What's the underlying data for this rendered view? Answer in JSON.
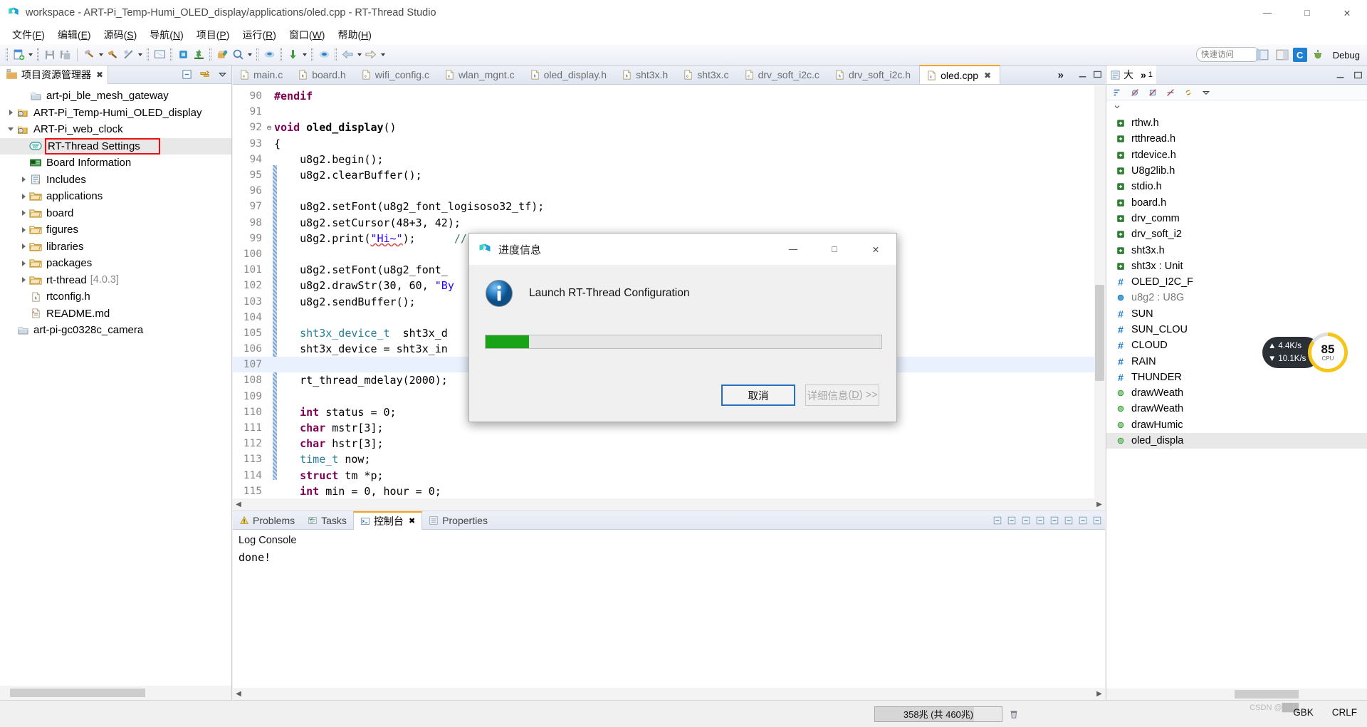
{
  "window": {
    "title": "workspace - ART-Pi_Temp-Humi_OLED_display/applications/oled.cpp - RT-Thread Studio",
    "minimize": "—",
    "maximize": "□",
    "close": "✕"
  },
  "menubar": {
    "items": [
      {
        "label": "文件",
        "mnemonic": "F"
      },
      {
        "label": "编辑",
        "mnemonic": "E"
      },
      {
        "label": "源码",
        "mnemonic": "S"
      },
      {
        "label": "导航",
        "mnemonic": "N"
      },
      {
        "label": "项目",
        "mnemonic": "P"
      },
      {
        "label": "运行",
        "mnemonic": "R"
      },
      {
        "label": "窗口",
        "mnemonic": "W"
      },
      {
        "label": "帮助",
        "mnemonic": "H"
      }
    ]
  },
  "toolbar": {
    "quick_access_placeholder": "快速访问",
    "perspective_c": "C",
    "perspective_debug": "Debug",
    "icons": [
      "new-project-icon",
      "save-icon",
      "save-all-icon",
      "build-hammer-icon",
      "build-all-icon",
      "clean-icon",
      "terminal-icon",
      "download-chip-icon",
      "flash-icon",
      "package-manager-icon",
      "search-icon",
      "sdk-manager-icon",
      "download-arrow-icon",
      "serial-icon",
      "back-icon",
      "forward-icon"
    ]
  },
  "project_explorer": {
    "tab_label": "项目资源管理器",
    "tab_close": "✖",
    "tools": [
      "collapse-all-icon",
      "link-editor-icon",
      "view-menu-icon"
    ],
    "nodes": [
      {
        "label": "art-pi_ble_mesh_gateway",
        "icon": "closed-project-icon",
        "indent": 1,
        "twisty": "none"
      },
      {
        "label": "ART-Pi_Temp-Humi_OLED_display",
        "icon": "c-project-icon",
        "indent": 0,
        "twisty": "collapsed"
      },
      {
        "label": "ART-Pi_web_clock",
        "icon": "c-project-icon",
        "indent": 0,
        "twisty": "expanded"
      },
      {
        "label": "RT-Thread Settings",
        "icon": "rt-settings-icon",
        "indent": 1,
        "twisty": "none",
        "selected": true,
        "highlighted": true
      },
      {
        "label": "Board Information",
        "icon": "board-info-icon",
        "indent": 1,
        "twisty": "none"
      },
      {
        "label": "Includes",
        "icon": "includes-icon",
        "indent": 1,
        "twisty": "collapsed"
      },
      {
        "label": "applications",
        "icon": "folder-icon",
        "indent": 1,
        "twisty": "collapsed"
      },
      {
        "label": "board",
        "icon": "folder-icon",
        "indent": 1,
        "twisty": "collapsed"
      },
      {
        "label": "figures",
        "icon": "folder-icon",
        "indent": 1,
        "twisty": "collapsed"
      },
      {
        "label": "libraries",
        "icon": "folder-icon",
        "indent": 1,
        "twisty": "collapsed"
      },
      {
        "label": "packages",
        "icon": "folder-icon",
        "indent": 1,
        "twisty": "collapsed"
      },
      {
        "label": "rt-thread",
        "version": "[4.0.3]",
        "icon": "folder-icon",
        "indent": 1,
        "twisty": "collapsed"
      },
      {
        "label": "rtconfig.h",
        "icon": "h-file-icon",
        "indent": 1,
        "twisty": "none"
      },
      {
        "label": "README.md",
        "icon": "md-file-icon",
        "indent": 1,
        "twisty": "none"
      },
      {
        "label": "art-pi-gc0328c_camera",
        "icon": "closed-project-icon",
        "indent": 0,
        "twisty": "none"
      }
    ]
  },
  "editor": {
    "tabs": [
      {
        "label": "main.c",
        "icon": "c-file-icon",
        "active": false
      },
      {
        "label": "board.h",
        "icon": "h-file-icon",
        "active": false
      },
      {
        "label": "wifi_config.c",
        "icon": "c-file-icon",
        "active": false
      },
      {
        "label": "wlan_mgnt.c",
        "icon": "c-file-icon",
        "active": false
      },
      {
        "label": "oled_display.h",
        "icon": "h-file-icon",
        "active": false
      },
      {
        "label": "sht3x.h",
        "icon": "h-file-icon",
        "active": false
      },
      {
        "label": "sht3x.c",
        "icon": "c-file-icon",
        "active": false
      },
      {
        "label": "drv_soft_i2c.c",
        "icon": "c-file-icon",
        "active": false
      },
      {
        "label": "drv_soft_i2c.h",
        "icon": "h-file-icon",
        "active": false
      },
      {
        "label": "oled.cpp",
        "icon": "cpp-file-icon",
        "active": true,
        "close": "✖"
      }
    ],
    "more_tabs": "»",
    "lines": [
      {
        "num": "90",
        "fold": "",
        "tokens": [
          {
            "t": "#endif",
            "c": "pp"
          }
        ]
      },
      {
        "num": "91",
        "fold": "",
        "tokens": []
      },
      {
        "num": "92",
        "fold": "⊖",
        "tokens": [
          {
            "t": "void ",
            "c": "kw"
          },
          {
            "t": "oled_display",
            "c": "fn"
          },
          {
            "t": "()",
            "c": ""
          }
        ]
      },
      {
        "num": "93",
        "fold": "",
        "tokens": [
          {
            "t": "{",
            "c": ""
          }
        ]
      },
      {
        "num": "94",
        "fold": "",
        "tokens": [
          {
            "t": "    u8g2.begin();",
            "c": ""
          }
        ]
      },
      {
        "num": "95",
        "fold": "",
        "tokens": [
          {
            "t": "    u8g2.clearBuffer();",
            "c": ""
          }
        ]
      },
      {
        "num": "96",
        "fold": "",
        "tokens": []
      },
      {
        "num": "97",
        "fold": "",
        "tokens": [
          {
            "t": "    u8g2.setFont(u8g2_font_logisoso32_tf);",
            "c": ""
          }
        ]
      },
      {
        "num": "98",
        "fold": "",
        "tokens": [
          {
            "t": "    u8g2.setCursor(48+3, 42);",
            "c": ""
          }
        ]
      },
      {
        "num": "99",
        "fold": "",
        "tokens": [
          {
            "t": "    u8g2.print(",
            "c": ""
          },
          {
            "t": "\"Hi~\"",
            "c": "str squig"
          },
          {
            "t": ");",
            "c": ""
          },
          {
            "t": "      // requires enableUTF8Print()",
            "c": "cmt"
          }
        ]
      },
      {
        "num": "100",
        "fold": "",
        "tokens": []
      },
      {
        "num": "101",
        "fold": "",
        "tokens": [
          {
            "t": "    u8g2.setFont(u8g2_font_",
            "c": ""
          }
        ]
      },
      {
        "num": "102",
        "fold": "",
        "tokens": [
          {
            "t": "    u8g2.drawStr(30, 60, ",
            "c": ""
          },
          {
            "t": "\"By",
            "c": "str"
          }
        ]
      },
      {
        "num": "103",
        "fold": "",
        "tokens": [
          {
            "t": "    u8g2.sendBuffer();",
            "c": ""
          }
        ]
      },
      {
        "num": "104",
        "fold": "",
        "tokens": []
      },
      {
        "num": "105",
        "fold": "",
        "tokens": [
          {
            "t": "    sht3x_device_t",
            "c": "typ"
          },
          {
            "t": "  sht3x_d",
            "c": ""
          }
        ]
      },
      {
        "num": "106",
        "fold": "",
        "tokens": [
          {
            "t": "    sht3x_device = sht3x_in",
            "c": ""
          }
        ]
      },
      {
        "num": "107",
        "fold": "",
        "tokens": [],
        "highlight": true
      },
      {
        "num": "108",
        "fold": "",
        "tokens": [
          {
            "t": "    rt_thread_mdelay(2000);",
            "c": ""
          }
        ]
      },
      {
        "num": "109",
        "fold": "",
        "tokens": []
      },
      {
        "num": "110",
        "fold": "",
        "tokens": [
          {
            "t": "    int",
            "c": "kw"
          },
          {
            "t": " status = 0;",
            "c": ""
          }
        ]
      },
      {
        "num": "111",
        "fold": "",
        "tokens": [
          {
            "t": "    char",
            "c": "kw"
          },
          {
            "t": " mstr[3];",
            "c": ""
          }
        ]
      },
      {
        "num": "112",
        "fold": "",
        "tokens": [
          {
            "t": "    char",
            "c": "kw"
          },
          {
            "t": " hstr[3];",
            "c": ""
          }
        ]
      },
      {
        "num": "113",
        "fold": "",
        "tokens": [
          {
            "t": "    time_t",
            "c": "typ"
          },
          {
            "t": " now;",
            "c": ""
          }
        ]
      },
      {
        "num": "114",
        "fold": "",
        "tokens": [
          {
            "t": "    struct",
            "c": "kw"
          },
          {
            "t": " tm *p;",
            "c": ""
          }
        ]
      },
      {
        "num": "115",
        "fold": "",
        "tokens": [
          {
            "t": "    int",
            "c": "kw"
          },
          {
            "t": " min = 0, hour = 0;",
            "c": ""
          }
        ]
      }
    ]
  },
  "outline": {
    "tab_label": "大",
    "tab_label2": "»",
    "tab_count": "1",
    "tools": [
      "sort-icon",
      "hide-fields-icon",
      "hide-static-icon",
      "hide-nonpublic-icon",
      "link-icon",
      "view-menu-icon"
    ],
    "nodes": [
      {
        "label": "rthw.h",
        "kind": "include"
      },
      {
        "label": "rtthread.h",
        "kind": "include"
      },
      {
        "label": "rtdevice.h",
        "kind": "include"
      },
      {
        "label": "U8g2lib.h",
        "kind": "include"
      },
      {
        "label": "stdio.h",
        "kind": "include"
      },
      {
        "label": "board.h",
        "kind": "include"
      },
      {
        "label": "drv_comm",
        "kind": "include"
      },
      {
        "label": "drv_soft_i2",
        "kind": "include"
      },
      {
        "label": "sht3x.h",
        "kind": "include"
      },
      {
        "label": "sht3x : Unit",
        "kind": "include"
      },
      {
        "label": "OLED_I2C_F",
        "kind": "define"
      },
      {
        "label": "u8g2 : U8G",
        "kind": "field"
      },
      {
        "label": "SUN",
        "kind": "define"
      },
      {
        "label": "SUN_CLOU",
        "kind": "define"
      },
      {
        "label": "CLOUD",
        "kind": "define"
      },
      {
        "label": "RAIN",
        "kind": "define"
      },
      {
        "label": "THUNDER",
        "kind": "define"
      },
      {
        "label": "drawWeath",
        "kind": "method"
      },
      {
        "label": "drawWeath",
        "kind": "method"
      },
      {
        "label": "drawHumic",
        "kind": "method"
      },
      {
        "label": "oled_displa",
        "kind": "method",
        "selected": true
      }
    ]
  },
  "console": {
    "tabs": [
      {
        "label": "Problems",
        "icon": "problems-icon",
        "active": false
      },
      {
        "label": "Tasks",
        "icon": "tasks-icon",
        "active": false
      },
      {
        "label": "控制台",
        "icon": "console-icon",
        "active": true,
        "close": "✖"
      },
      {
        "label": "Properties",
        "icon": "properties-icon",
        "active": false
      }
    ],
    "title": "Log Console",
    "lines": [
      "done!"
    ],
    "tools": [
      "clear-icon",
      "scroll-lock-icon",
      "pin-icon",
      "new-console-icon",
      "display-console-icon",
      "open-console-icon",
      "minimize-icon",
      "maximize-icon"
    ]
  },
  "statusbar": {
    "memory_text": "358兆 (共 460兆)",
    "memory_percent": 78,
    "trash_icon": "trash-icon",
    "encoding": "GBK",
    "line_ending": "CRLF",
    "watermark": "CSDN @███"
  },
  "net_widget": {
    "down_speed": "4.4K/s",
    "up_speed": "10.1K/s",
    "cpu_percent": "85",
    "cpu_unit": "%",
    "cpu_label": "CPU"
  },
  "dialog": {
    "title": "进度信息",
    "icon": "rt-thread-logo-icon",
    "message": "Launch RT-Thread Configuration",
    "progress_percent": 11,
    "cancel_label": "取消",
    "details_label": "详细信息",
    "details_mnemonic": "D",
    "details_suffix": ">>",
    "minimize": "—",
    "maximize": "□",
    "close": "✕"
  },
  "colors": {
    "accent_blue": "#1f7fd0",
    "progress_green": "#19a319",
    "highlight_red": "#ee0f10",
    "tab_active_top": "#f5a623"
  }
}
